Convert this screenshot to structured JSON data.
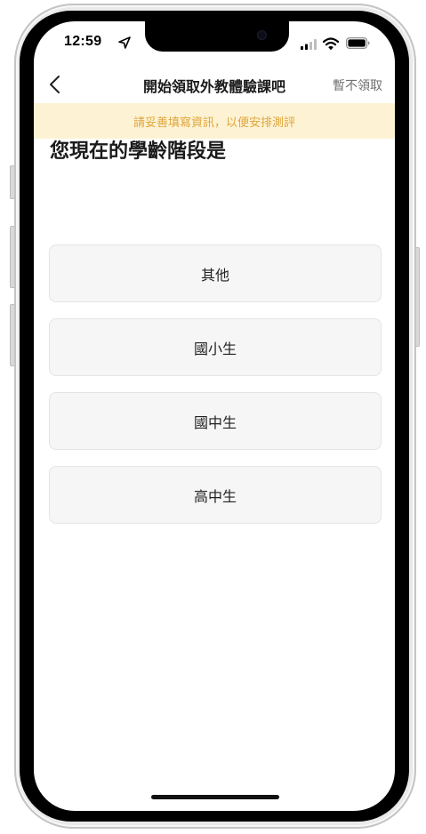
{
  "status_bar": {
    "time": "12:59"
  },
  "nav": {
    "title": "開始領取外教體驗課吧",
    "skip_label": "暫不領取"
  },
  "notice": {
    "text": "請妥善填寫資訊，以便安排測評",
    "color": "#e0a43a",
    "background": "#fdf3d4"
  },
  "question": {
    "text": "您現在的學齡階段是"
  },
  "options": [
    {
      "label": "其他"
    },
    {
      "label": "國小生"
    },
    {
      "label": "國中生"
    },
    {
      "label": "高中生"
    }
  ],
  "icons": {
    "back": "chevron-left-icon",
    "location": "location-arrow-icon",
    "signal": "cellular-signal-icon",
    "wifi": "wifi-icon",
    "battery": "battery-icon"
  }
}
